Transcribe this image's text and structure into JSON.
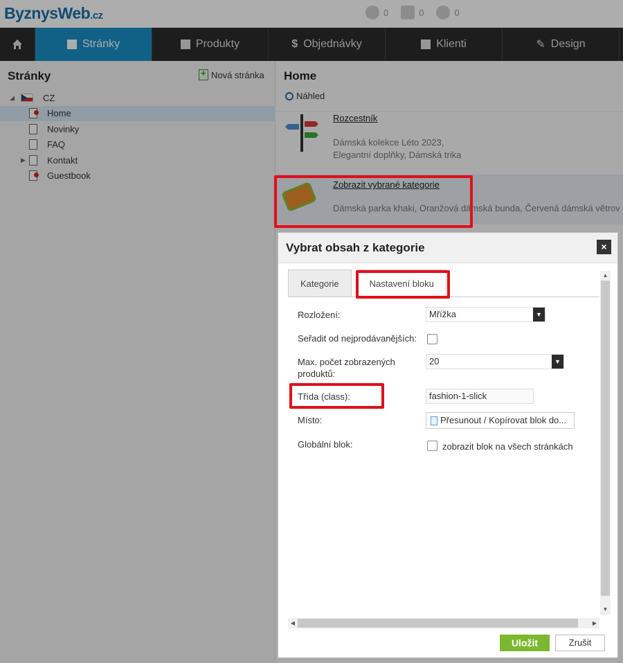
{
  "brand": {
    "part1": "ByznysWeb",
    "part2": ".cz"
  },
  "counters": [
    "0",
    "0",
    "0"
  ],
  "nav": {
    "items": [
      {
        "label": "Stránky"
      },
      {
        "label": "Produkty"
      },
      {
        "label": "Objednávky"
      },
      {
        "label": "Klienti"
      },
      {
        "label": "Design"
      }
    ]
  },
  "sidebar": {
    "title": "Stránky",
    "new_page": "Nová stránka",
    "tree": {
      "root": "CZ",
      "items": [
        "Home",
        "Novinky",
        "FAQ",
        "Kontakt",
        "Guestbook"
      ]
    }
  },
  "main": {
    "title": "Home",
    "preview": "Náhled",
    "blocks": [
      {
        "title": "Rozcestník",
        "desc": "Dámská kolekce Léto 2023, Elegantní doplňky, Dámská trika"
      },
      {
        "title": "Zobrazit vybrané kategorie",
        "desc": "Dámská parka khaki, Oranžová dámská bunda, Červená dámská větrov"
      }
    ]
  },
  "dialog": {
    "title": "Vybrat obsah z kategorie",
    "close": "×",
    "tabs": [
      "Kategorie",
      "Nastavení bloku"
    ],
    "fields": {
      "layout_label": "Rozložení:",
      "layout_value": "Mřížka",
      "sort_label": "Seřadit od nejprodávanějších:",
      "max_label": "Max. počet zobrazených produktů:",
      "max_value": "20",
      "class_label": "Třída (class):",
      "class_value": "fashion-1-slick",
      "place_label": "Místo:",
      "place_button": "Přesunout / Kopírovat blok do...",
      "global_label": "Globální blok:",
      "global_option": "zobrazit blok na všech stránkách"
    },
    "save": "Uložit",
    "cancel": "Zrušit"
  }
}
